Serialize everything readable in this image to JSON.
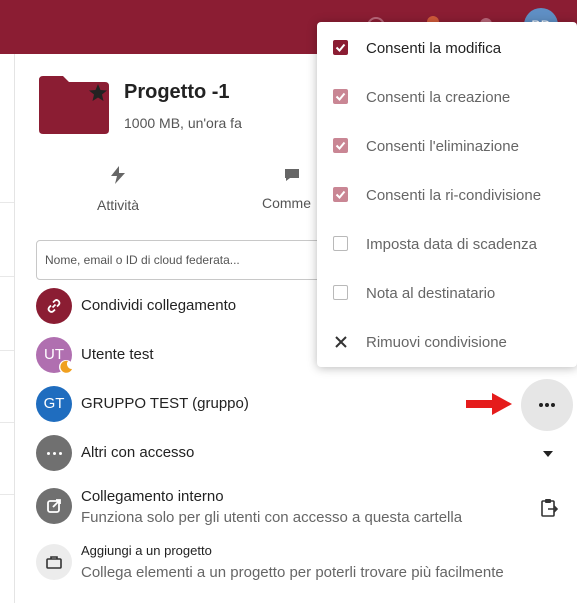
{
  "colors": {
    "brand": "#8b1d33",
    "group_avatar": "#1f6dbf",
    "grey_avatar": "#707070"
  },
  "file": {
    "name": "Progetto -1",
    "meta": "1000 MB, un'ora fa"
  },
  "tabs": [
    {
      "label": "Attività",
      "icon": "activity-icon"
    },
    {
      "label": "Comme",
      "icon": "comments-icon"
    }
  ],
  "search": {
    "placeholder": "Nome, email o ID di cloud federata..."
  },
  "shares": [
    {
      "icon": "link-icon",
      "label": "Condividi collegamento"
    },
    {
      "initials": "UT",
      "label": "Utente test"
    },
    {
      "initials": "GT",
      "label": "GRUPPO TEST (gruppo)"
    },
    {
      "icon": "more-icon",
      "label": "Altri con accesso"
    },
    {
      "icon": "external-link-icon",
      "label": "Collegamento interno",
      "sub": "Funziona solo per gli utenti con accesso a questa cartella"
    },
    {
      "icon": "project-icon",
      "label": "Aggiungi a un progetto",
      "sub": "Collega elementi a un progetto per poterli trovare più facilmente"
    }
  ],
  "menu": {
    "items": [
      {
        "label": "Consenti la modifica",
        "checked": true
      },
      {
        "label": "Consenti la creazione",
        "checked": true
      },
      {
        "label": "Consenti l'eliminazione",
        "checked": true
      },
      {
        "label": "Consenti la ri-condivisione",
        "checked": true
      },
      {
        "label": "Imposta data di scadenza",
        "checked": false
      },
      {
        "label": "Nota al destinatario",
        "checked": false
      },
      {
        "label": "Rimuovi condivisione",
        "icon": "close-icon"
      }
    ]
  },
  "header": {
    "avatar_initials": "BD"
  }
}
